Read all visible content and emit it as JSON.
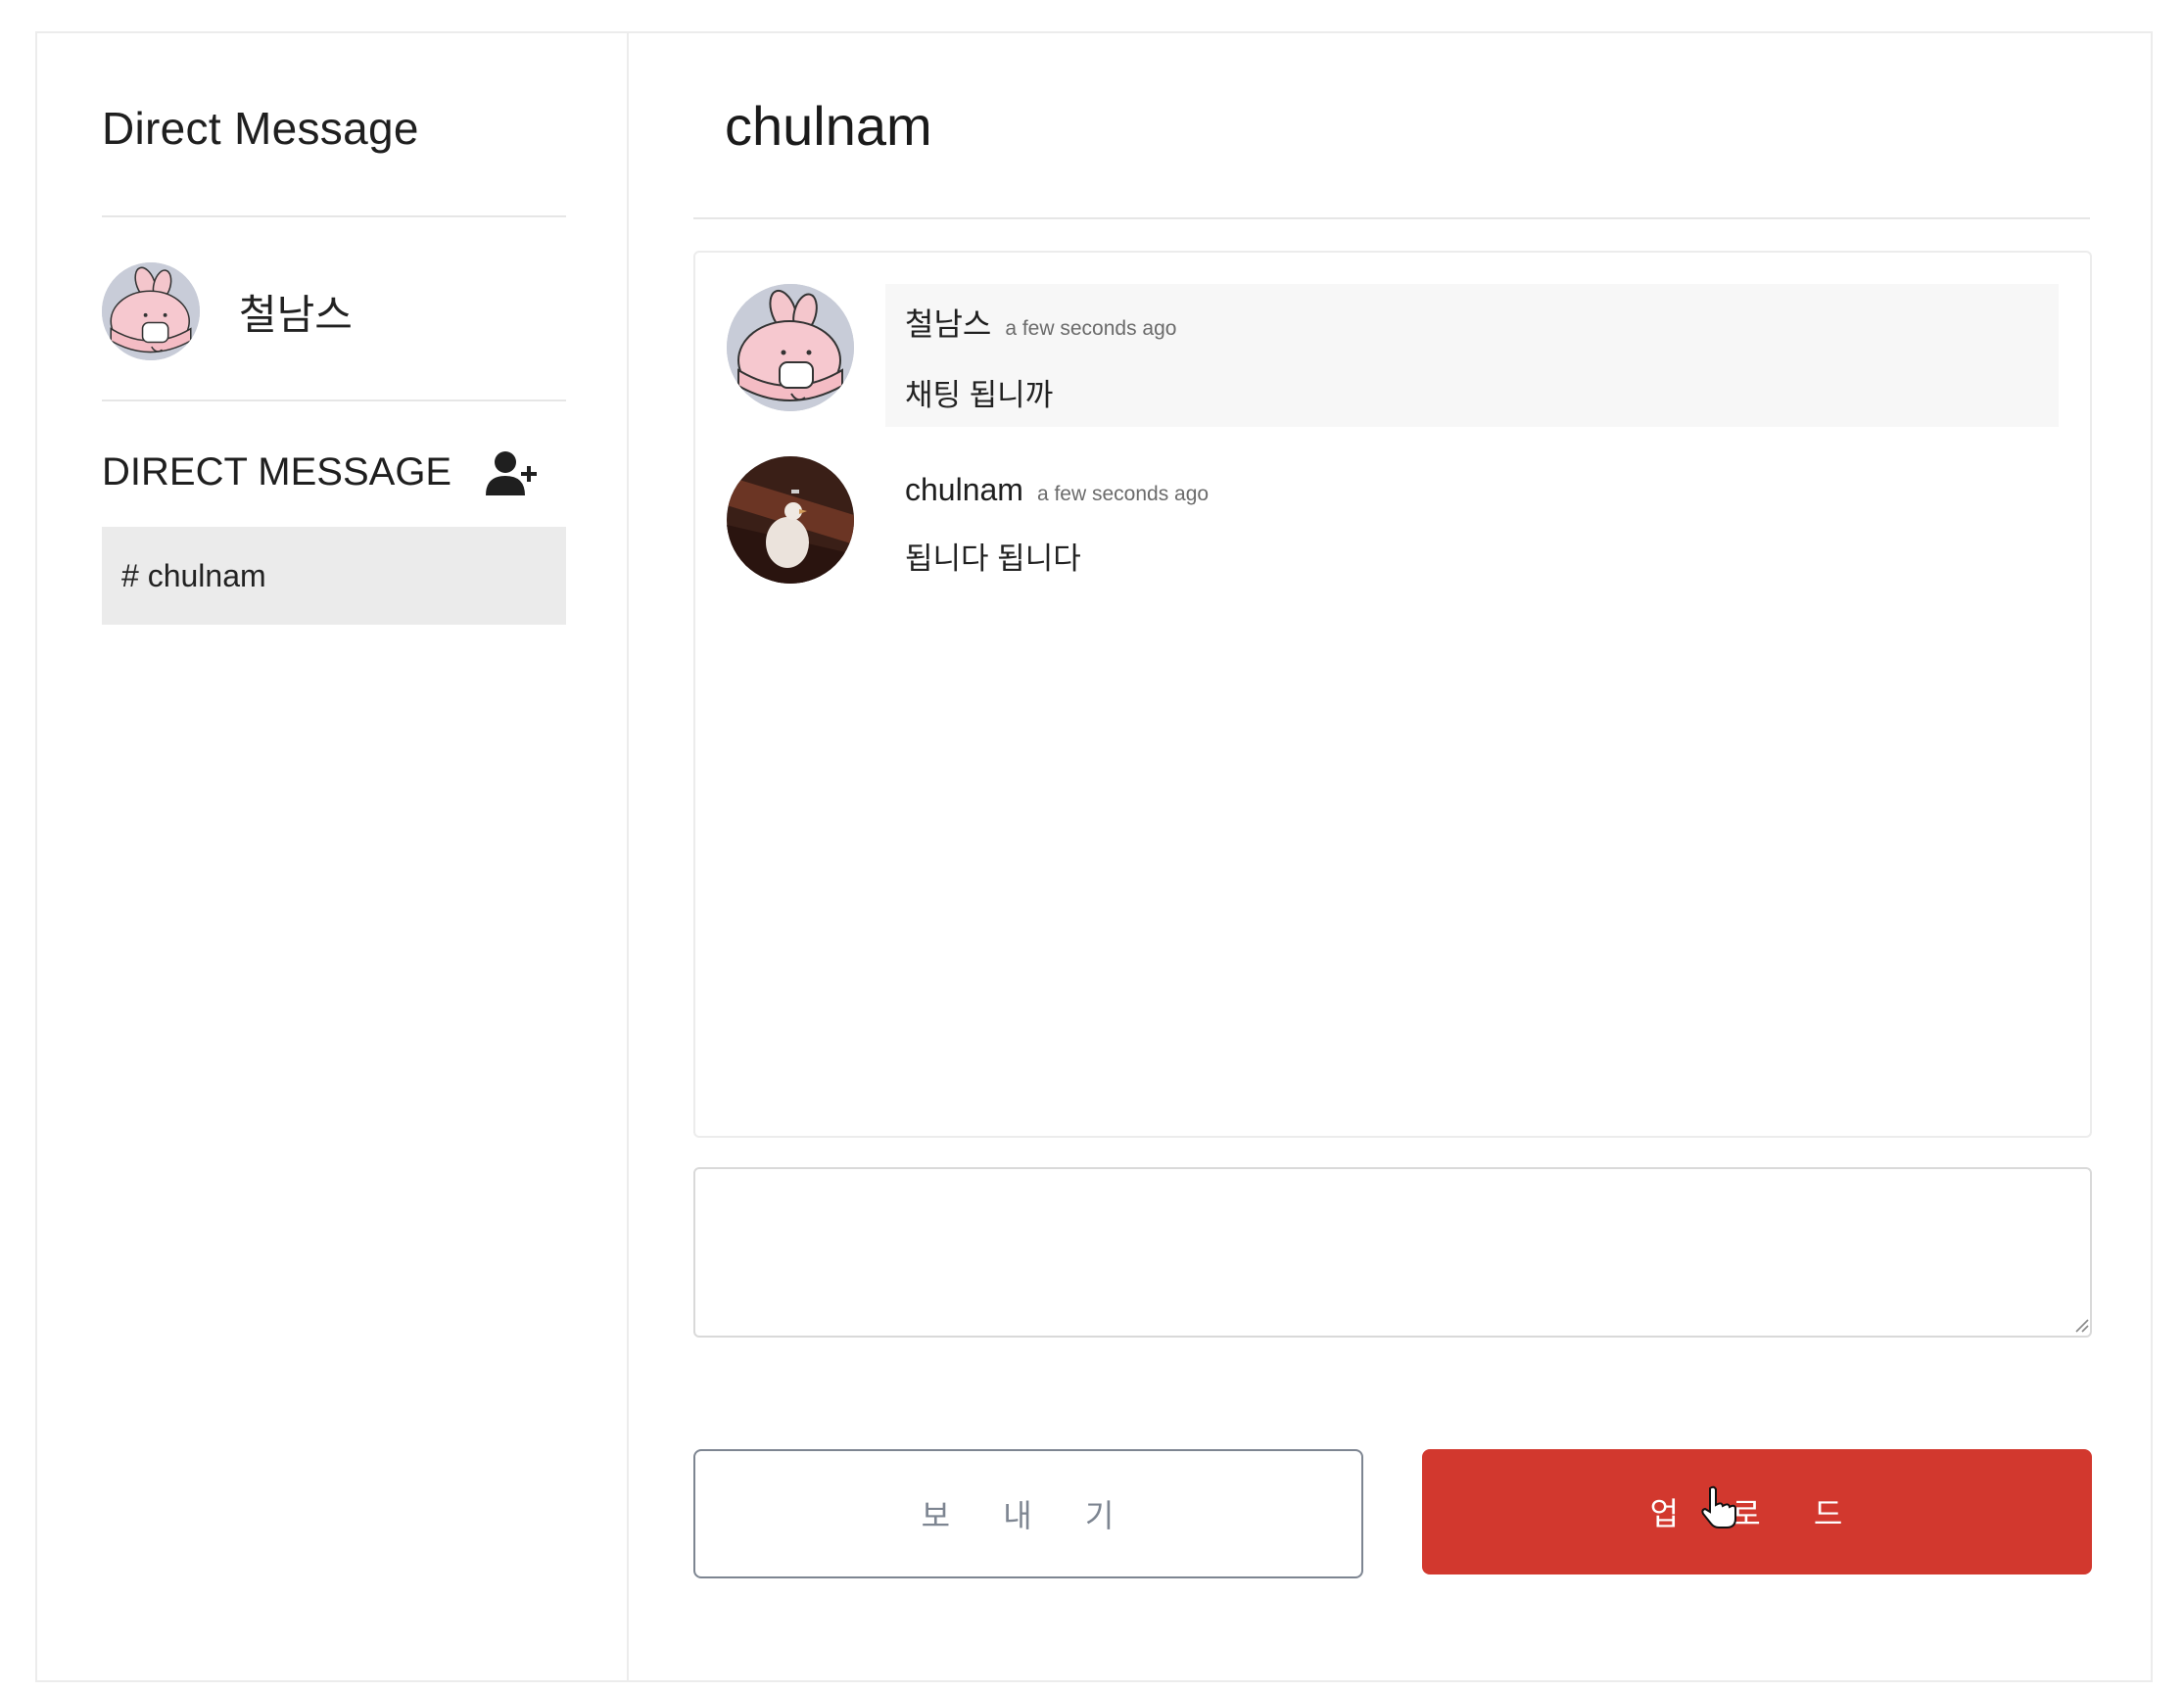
{
  "sidebar": {
    "title": "Direct Message",
    "profile": {
      "name": "철남스",
      "avatar_icon": "pink-bunny-avatar-icon"
    },
    "dm_section": {
      "label": "DIRECT MESSAGE",
      "add_icon": "add-user-icon"
    },
    "channels": [
      {
        "label": "# chulnam",
        "selected": true
      }
    ]
  },
  "main": {
    "title": "chulnam",
    "messages": [
      {
        "author": "철남스",
        "time": "a few seconds ago",
        "text": "채팅 됩니까",
        "avatar_icon": "pink-bunny-avatar-icon",
        "highlighted": true
      },
      {
        "author": "chulnam",
        "time": "a few seconds ago",
        "text": "됩니다 됩니다",
        "avatar_icon": "duck-photo-avatar-icon",
        "highlighted": false
      }
    ],
    "composer": {
      "value": "",
      "placeholder": ""
    },
    "buttons": {
      "send_label": "보 내 기",
      "upload_label": "업 로 드"
    }
  },
  "colors": {
    "accent_red": "#d2382e",
    "send_border": "#7d8591",
    "selected_bg": "#ebebeb"
  }
}
